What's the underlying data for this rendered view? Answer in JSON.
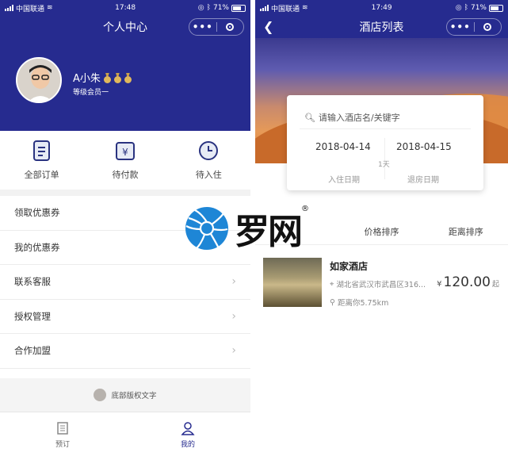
{
  "left": {
    "status": {
      "carrier": "中国联通",
      "time": "17:48",
      "battery": "71%"
    },
    "title": "个人中心",
    "user": {
      "name": "A小朱",
      "level": "等级会员一"
    },
    "orders": [
      {
        "label": "全部订单",
        "icon": "order-list-icon"
      },
      {
        "label": "待付款",
        "icon": "yen-wallet-icon"
      },
      {
        "label": "待入住",
        "icon": "clock-icon"
      }
    ],
    "menu": [
      {
        "label": "领取优惠券",
        "chevron": false
      },
      {
        "label": "我的优惠券",
        "chevron": false
      },
      {
        "label": "联系客服",
        "chevron": true
      },
      {
        "label": "授权管理",
        "chevron": true
      },
      {
        "label": "合作加盟",
        "chevron": true
      }
    ],
    "copyright": "底部版权文字",
    "tabs": [
      {
        "label": "预订",
        "icon": "building-icon",
        "active": false
      },
      {
        "label": "我的",
        "icon": "person-icon",
        "active": true
      }
    ]
  },
  "right": {
    "status": {
      "carrier": "中国联通",
      "time": "17:49",
      "battery": "71%"
    },
    "title": "酒店列表",
    "search": {
      "placeholder": "请输入酒店名/关键字"
    },
    "checkin": {
      "date": "2018-04-14",
      "label": "入住日期"
    },
    "checkout": {
      "date": "2018-04-15",
      "label": "退房日期"
    },
    "nights": "1天",
    "sort": [
      "价格排序",
      "距离排序"
    ],
    "hotel": {
      "name": "如家酒店",
      "address": "湖北省武汉市武昌区316...",
      "distance": "距离你5.75km",
      "currency": "¥",
      "price": "120.00",
      "price_suffix": "起"
    }
  },
  "watermark": {
    "text": "罗网",
    "reg": "®"
  },
  "colors": {
    "primary": "#262b8f",
    "watermark_blue": "#1e86d6"
  }
}
